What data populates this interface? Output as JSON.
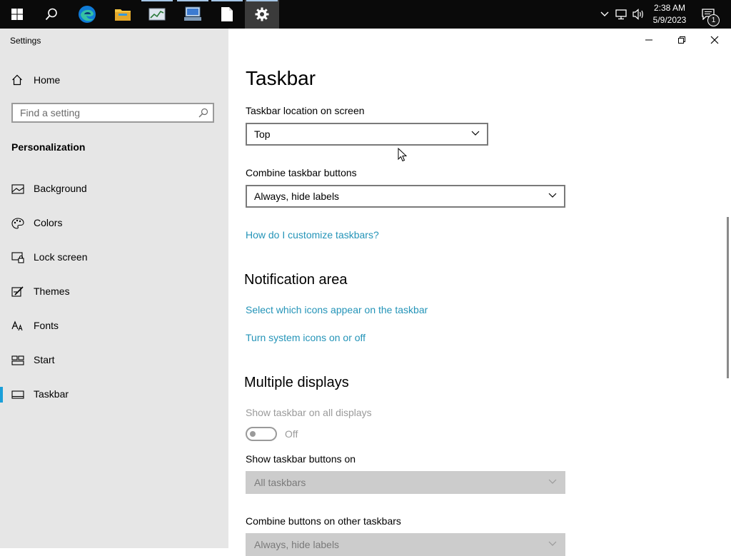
{
  "taskbar": {
    "clock": {
      "time": "2:38 AM",
      "date": "5/9/2023"
    },
    "notification_count": "1"
  },
  "window": {
    "title": "Settings"
  },
  "sidebar": {
    "home_label": "Home",
    "search_placeholder": "Find a setting",
    "section": "Personalization",
    "items": [
      {
        "label": "Background",
        "icon": "picture-icon"
      },
      {
        "label": "Colors",
        "icon": "palette-icon"
      },
      {
        "label": "Lock screen",
        "icon": "lock-screen-icon"
      },
      {
        "label": "Themes",
        "icon": "brush-icon"
      },
      {
        "label": "Fonts",
        "icon": "font-icon"
      },
      {
        "label": "Start",
        "icon": "start-icon"
      },
      {
        "label": "Taskbar",
        "icon": "taskbar-icon",
        "selected": true
      }
    ]
  },
  "main": {
    "title": "Taskbar",
    "location_label": "Taskbar location on screen",
    "location_value": "Top",
    "combine_label": "Combine taskbar buttons",
    "combine_value": "Always, hide labels",
    "customize_link": "How do I customize taskbars?",
    "notification_area": {
      "heading": "Notification area",
      "link_icons": "Select which icons appear on the taskbar",
      "link_system": "Turn system icons on or off"
    },
    "multiple_displays": {
      "heading": "Multiple displays",
      "show_all_label": "Show taskbar on all displays",
      "show_all_state": "Off",
      "buttons_on_label": "Show taskbar buttons on",
      "buttons_on_value": "All taskbars",
      "combine_other_label": "Combine buttons on other taskbars",
      "combine_other_value": "Always, hide labels"
    }
  },
  "colors": {
    "accent": "#1a9fd9",
    "link": "#2494b8",
    "sidebar_bg": "#e6e6e6",
    "taskbar_bg": "#0a0a0a"
  }
}
